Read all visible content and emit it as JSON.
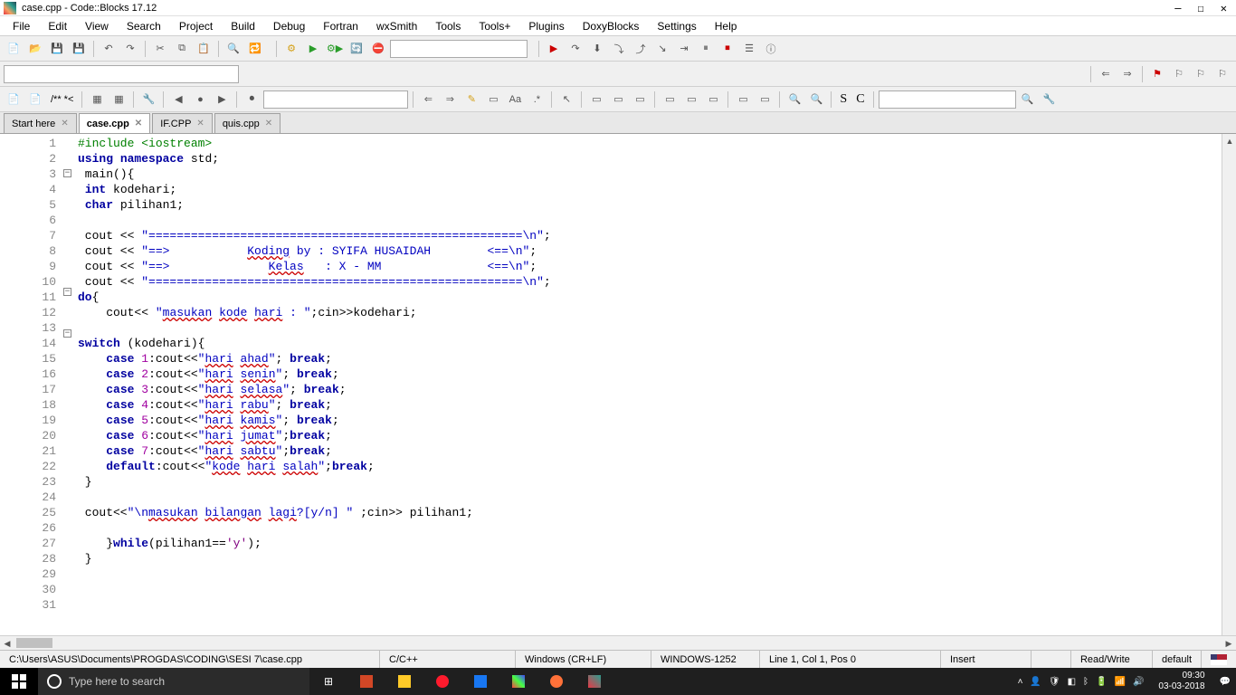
{
  "title": "case.cpp - Code::Blocks 17.12",
  "menu": [
    "File",
    "Edit",
    "View",
    "Search",
    "Project",
    "Build",
    "Debug",
    "Fortran",
    "wxSmith",
    "Tools",
    "Tools+",
    "Plugins",
    "DoxyBlocks",
    "Settings",
    "Help"
  ],
  "toolbar3": {
    "comment": "/** *<",
    "letters": [
      "S",
      "C"
    ]
  },
  "tabs": [
    {
      "label": "Start here",
      "active": false
    },
    {
      "label": "case.cpp",
      "active": true
    },
    {
      "label": "IF.CPP",
      "active": false
    },
    {
      "label": "quis.cpp",
      "active": false
    }
  ],
  "code_lines": [
    {
      "n": 1,
      "fold": "",
      "html": "<span class='pp'>#include &lt;iostream&gt;</span>"
    },
    {
      "n": 2,
      "fold": "",
      "html": "<span class='kw'>using</span> <span class='kw'>namespace</span> std;"
    },
    {
      "n": 3,
      "fold": "-",
      "html": " main(){"
    },
    {
      "n": 4,
      "fold": "",
      "html": " <span class='kw'>int</span> kodehari;"
    },
    {
      "n": 5,
      "fold": "",
      "html": " <span class='kw'>char</span> pilihan1;"
    },
    {
      "n": 6,
      "fold": "",
      "html": ""
    },
    {
      "n": 7,
      "fold": "",
      "html": " cout &lt;&lt; <span class='str'>\"=====================================================\\n\"</span>;"
    },
    {
      "n": 8,
      "fold": "",
      "html": " cout &lt;&lt; <span class='str'>\"==&gt;           <span class='underline'>Koding</span> by : SYIFA HUSAIDAH        &lt;==\\n\"</span>;"
    },
    {
      "n": 9,
      "fold": "",
      "html": " cout &lt;&lt; <span class='str'>\"==&gt;              <span class='underline'>Kelas</span>   : X - MM               &lt;==\\n\"</span>;"
    },
    {
      "n": 10,
      "fold": "",
      "html": " cout &lt;&lt; <span class='str'>\"=====================================================\\n\"</span>;"
    },
    {
      "n": 11,
      "fold": "-",
      "html": "<span class='kw'>do</span>{"
    },
    {
      "n": 12,
      "fold": "",
      "html": "    cout&lt;&lt; <span class='str'>\"<span class='underline'>masukan</span> <span class='underline'>kode</span> <span class='underline'>hari</span> : \"</span>;cin&gt;&gt;kodehari;"
    },
    {
      "n": 13,
      "fold": "",
      "html": ""
    },
    {
      "n": 14,
      "fold": "-",
      "html": "<span class='kw'>switch</span> (kodehari){"
    },
    {
      "n": 15,
      "fold": "",
      "html": "    <span class='kw'>case</span> <span class='num'>1</span>:cout&lt;&lt;<span class='str'>\"<span class='underline'>hari</span> <span class='underline'>ahad</span>\"</span>; <span class='kw'>break</span>;"
    },
    {
      "n": 16,
      "fold": "",
      "html": "    <span class='kw'>case</span> <span class='num'>2</span>:cout&lt;&lt;<span class='str'>\"<span class='underline'>hari</span> <span class='underline'>senin</span>\"</span>; <span class='kw'>break</span>;"
    },
    {
      "n": 17,
      "fold": "",
      "html": "    <span class='kw'>case</span> <span class='num'>3</span>:cout&lt;&lt;<span class='str'>\"<span class='underline'>hari</span> <span class='underline'>selasa</span>\"</span>; <span class='kw'>break</span>;"
    },
    {
      "n": 18,
      "fold": "",
      "html": "    <span class='kw'>case</span> <span class='num'>4</span>:cout&lt;&lt;<span class='str'>\"<span class='underline'>hari</span> <span class='underline'>rabu</span>\"</span>; <span class='kw'>break</span>;"
    },
    {
      "n": 19,
      "fold": "",
      "html": "    <span class='kw'>case</span> <span class='num'>5</span>:cout&lt;&lt;<span class='str'>\"<span class='underline'>hari</span> <span class='underline'>kamis</span>\"</span>; <span class='kw'>break</span>;"
    },
    {
      "n": 20,
      "fold": "",
      "html": "    <span class='kw'>case</span> <span class='num'>6</span>:cout&lt;&lt;<span class='str'>\"<span class='underline'>hari</span> <span class='underline'>jumat</span>\"</span>;<span class='kw'>break</span>;"
    },
    {
      "n": 21,
      "fold": "",
      "html": "    <span class='kw'>case</span> <span class='num'>7</span>:cout&lt;&lt;<span class='str'>\"<span class='underline'>hari</span> <span class='underline'>sabtu</span>\"</span>;<span class='kw'>break</span>;"
    },
    {
      "n": 22,
      "fold": "",
      "html": "    <span class='kw'>default</span>:cout&lt;&lt;<span class='str'>\"<span class='underline'>kode</span> <span class='underline'>hari</span> <span class='underline'>salah</span>\"</span>;<span class='kw'>break</span>;"
    },
    {
      "n": 23,
      "fold": "",
      "html": " }"
    },
    {
      "n": 24,
      "fold": "",
      "html": ""
    },
    {
      "n": 25,
      "fold": "",
      "html": " cout&lt;&lt;<span class='str'>\"\\n<span class='underline'>masukan</span> <span class='underline'>bilangan</span> <span class='underline'>lagi</span>?[y/n] \"</span> ;cin&gt;&gt; pilihan1;"
    },
    {
      "n": 26,
      "fold": "",
      "html": ""
    },
    {
      "n": 27,
      "fold": "",
      "html": "    }<span class='kw'>while</span>(pilihan1==<span class='char'>'y'</span>);"
    },
    {
      "n": 28,
      "fold": "",
      "html": " }"
    },
    {
      "n": 29,
      "fold": "",
      "html": ""
    },
    {
      "n": 30,
      "fold": "",
      "html": ""
    },
    {
      "n": 31,
      "fold": "",
      "html": ""
    }
  ],
  "status": {
    "path": "C:\\Users\\ASUS\\Documents\\PROGDAS\\CODING\\SESI 7\\case.cpp",
    "lang": "C/C++",
    "eol": "Windows (CR+LF)",
    "enc": "WINDOWS-1252",
    "pos": "Line 1, Col 1, Pos 0",
    "insert": "Insert",
    "rw": "Read/Write",
    "scheme": "default"
  },
  "taskbar": {
    "search_placeholder": "Type here to search",
    "time": "09:30",
    "date": "03-03-2018"
  }
}
